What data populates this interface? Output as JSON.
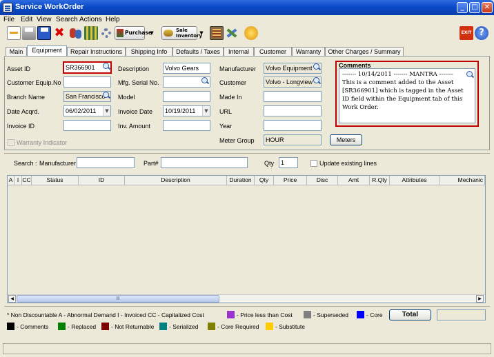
{
  "window": {
    "title": "Service WorkOrder"
  },
  "menu": [
    "File",
    "Edit",
    "View",
    "Search",
    "Actions",
    "Help"
  ],
  "toolbar": {
    "purchase_label": "Purchase",
    "sale_inventory_label1": "Sale",
    "sale_inventory_label2": "Inventory",
    "exit_label": "EXIT"
  },
  "tabs": [
    "Main",
    "Equipment",
    "Repair Instructions",
    "Shipping Info",
    "Defaults / Taxes",
    "Internal",
    "Customer",
    "Warranty",
    "Other Charges / Summary"
  ],
  "equipment": {
    "asset_id_label": "Asset ID",
    "asset_id": "SR366901",
    "customer_equip_label": "Customer Equip.No",
    "customer_equip": "",
    "branch_label": "Branch Name",
    "branch": "San Francisco",
    "date_acqrd_label": "Date Acqrd.",
    "date_acqrd": "06/02/2011",
    "invoice_id_label": "Invoice ID",
    "invoice_id": "",
    "description_label": "Description",
    "description": "Volvo Gears",
    "mfg_serial_label": "Mfg. Serial No.",
    "mfg_serial": "",
    "model_label": "Model",
    "model": "",
    "invoice_date_label": "Invoice Date",
    "invoice_date": "10/19/2011",
    "inv_amount_label": "Inv. Amount",
    "inv_amount": "",
    "manufacturer_label": "Manufacturer",
    "manufacturer": "Volvo Equipment",
    "customer_label": "Customer",
    "customer": "Volvo - Longview",
    "made_in_label": "Made In",
    "made_in": "",
    "url_label": "URL",
    "url": "",
    "year_label": "Year",
    "year": "",
    "meter_group_label": "Meter Group",
    "meter_group": "HOUR",
    "meters_button": "Meters",
    "warranty_indicator": "Warranty Indicator"
  },
  "comments": {
    "title": "Comments",
    "line1": "------- 10/14/2011 ------- MANTRA -------",
    "body": "This is a comment added to the Asset [SR366901] which is tagged in the Asset ID field within the Equipment tab of this Work Order."
  },
  "search": {
    "search_label": "Search :",
    "manufacturer_label": "Manufacturer",
    "manufacturer": "",
    "part_label": "Part#",
    "part": "",
    "qty_label": "Qty",
    "qty": "1",
    "update_existing": "Update existing lines"
  },
  "grid": {
    "columns": [
      "A",
      "I",
      "CC",
      "Status",
      "ID",
      "Description",
      "Duration",
      "Qty",
      "Price",
      "Disc",
      "Amt",
      "R.Qty",
      "Attributes",
      "Mechanic"
    ],
    "scroll_grip": "lll"
  },
  "legend": {
    "line1": [
      {
        "text": "* Non Discountable   A - Abnormal Demand   I - Invoiced   CC - Capitalized Cost"
      },
      {
        "color": "#9933CC",
        "text": "- Price less than Cost"
      },
      {
        "color": "#808080",
        "text": "- Superseded"
      },
      {
        "color": "#0000FF",
        "text": "- Core"
      }
    ],
    "line2": [
      {
        "color": "#000000",
        "text": "- Comments"
      },
      {
        "color": "#008000",
        "text": "- Replaced"
      },
      {
        "color": "#800000",
        "text": "- Not Returnable"
      },
      {
        "color": "#008080",
        "text": "- Serialized"
      },
      {
        "color": "#808000",
        "text": "- Core Required"
      },
      {
        "color": "#FFCC00",
        "text": "- Substitute"
      }
    ],
    "total_button": "Total",
    "total_value": ""
  }
}
